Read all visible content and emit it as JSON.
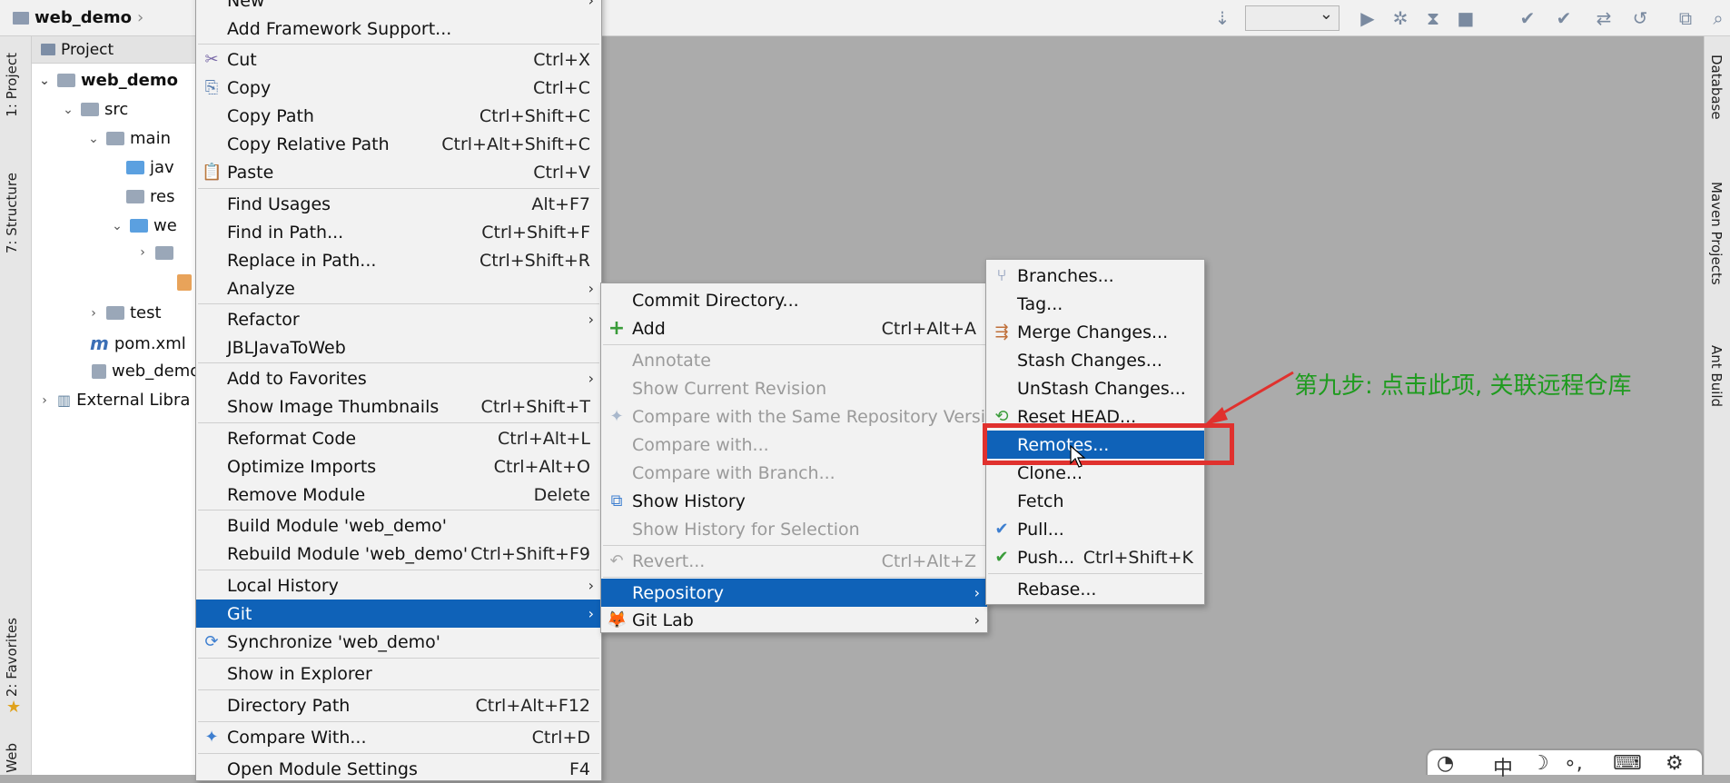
{
  "breadcrumb": {
    "project": "web_demo"
  },
  "left_tabs": [
    "1: Project",
    "7: Structure",
    "2: Favorites",
    "Web"
  ],
  "right_tabs": [
    "Database",
    "Maven Projects",
    "Ant Build"
  ],
  "project_panel": {
    "title": "Project",
    "tree": [
      {
        "label": "web_demo",
        "bold": true
      },
      {
        "label": "src"
      },
      {
        "label": "main"
      },
      {
        "label": "jav"
      },
      {
        "label": "res"
      },
      {
        "label": "we"
      },
      {
        "label": ""
      },
      {
        "label": "test"
      },
      {
        "label": "pom.xml"
      },
      {
        "label": "web_demo"
      },
      {
        "label": "External Libra"
      }
    ]
  },
  "context_menu": {
    "items": [
      {
        "label": "New",
        "shortcut": ""
      },
      {
        "label": "Add Framework Support...",
        "shortcut": ""
      },
      {
        "label": "Cut",
        "shortcut": "Ctrl+X"
      },
      {
        "label": "Copy",
        "shortcut": "Ctrl+C"
      },
      {
        "label": "Copy Path",
        "shortcut": "Ctrl+Shift+C"
      },
      {
        "label": "Copy Relative Path",
        "shortcut": "Ctrl+Alt+Shift+C"
      },
      {
        "label": "Paste",
        "shortcut": "Ctrl+V"
      },
      {
        "label": "Find Usages",
        "shortcut": "Alt+F7"
      },
      {
        "label": "Find in Path...",
        "shortcut": "Ctrl+Shift+F"
      },
      {
        "label": "Replace in Path...",
        "shortcut": "Ctrl+Shift+R"
      },
      {
        "label": "Analyze",
        "shortcut": ""
      },
      {
        "label": "Refactor",
        "shortcut": ""
      },
      {
        "label": "JBLJavaToWeb",
        "shortcut": ""
      },
      {
        "label": "Add to Favorites",
        "shortcut": ""
      },
      {
        "label": "Show Image Thumbnails",
        "shortcut": "Ctrl+Shift+T"
      },
      {
        "label": "Reformat Code",
        "shortcut": "Ctrl+Alt+L"
      },
      {
        "label": "Optimize Imports",
        "shortcut": "Ctrl+Alt+O"
      },
      {
        "label": "Remove Module",
        "shortcut": "Delete"
      },
      {
        "label": "Build Module 'web_demo'",
        "shortcut": ""
      },
      {
        "label": "Rebuild Module 'web_demo'",
        "shortcut": "Ctrl+Shift+F9"
      },
      {
        "label": "Local History",
        "shortcut": ""
      },
      {
        "label": "Git",
        "shortcut": ""
      },
      {
        "label": "Synchronize 'web_demo'",
        "shortcut": ""
      },
      {
        "label": "Show in Explorer",
        "shortcut": ""
      },
      {
        "label": "Directory Path",
        "shortcut": "Ctrl+Alt+F12"
      },
      {
        "label": "Compare With...",
        "shortcut": "Ctrl+D"
      },
      {
        "label": "Open Module Settings",
        "shortcut": "F4"
      }
    ]
  },
  "git_menu": {
    "items": [
      {
        "label": "Commit Directory...",
        "shortcut": ""
      },
      {
        "label": "Add",
        "shortcut": "Ctrl+Alt+A"
      },
      {
        "label": "Annotate",
        "shortcut": ""
      },
      {
        "label": "Show Current Revision",
        "shortcut": ""
      },
      {
        "label": "Compare with the Same Repository Version",
        "shortcut": ""
      },
      {
        "label": "Compare with...",
        "shortcut": ""
      },
      {
        "label": "Compare with Branch...",
        "shortcut": ""
      },
      {
        "label": "Show History",
        "shortcut": ""
      },
      {
        "label": "Show History for Selection",
        "shortcut": ""
      },
      {
        "label": "Revert...",
        "shortcut": "Ctrl+Alt+Z"
      },
      {
        "label": "Repository",
        "shortcut": ""
      },
      {
        "label": "Git Lab",
        "shortcut": ""
      }
    ]
  },
  "repository_menu": {
    "items": [
      {
        "label": "Branches...",
        "shortcut": ""
      },
      {
        "label": "Tag...",
        "shortcut": ""
      },
      {
        "label": "Merge Changes...",
        "shortcut": ""
      },
      {
        "label": "Stash Changes...",
        "shortcut": ""
      },
      {
        "label": "UnStash Changes...",
        "shortcut": ""
      },
      {
        "label": "Reset HEAD...",
        "shortcut": ""
      },
      {
        "label": "Remotes...",
        "shortcut": ""
      },
      {
        "label": "Clone...",
        "shortcut": ""
      },
      {
        "label": "Fetch",
        "shortcut": ""
      },
      {
        "label": "Pull...",
        "shortcut": ""
      },
      {
        "label": "Push...",
        "shortcut": "Ctrl+Shift+K"
      },
      {
        "label": "Rebase...",
        "shortcut": ""
      }
    ]
  },
  "annotation": {
    "text": "第九步: 点击此项, 关联远程仓库"
  },
  "colors": {
    "highlight": "#0f62b8",
    "annotation_text": "#1f9b1f",
    "annotation_box": "#e0312e"
  }
}
